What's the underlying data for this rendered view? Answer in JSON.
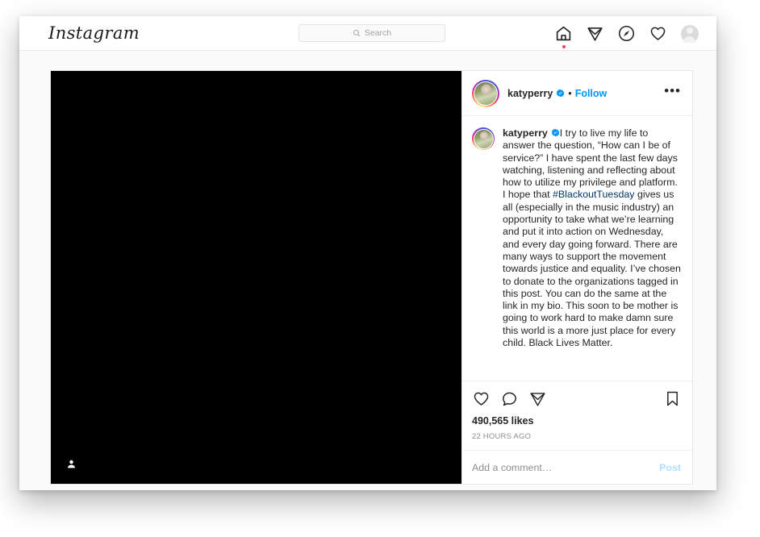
{
  "app": {
    "brand": "Instagram"
  },
  "navbar": {
    "search": {
      "icon": "search-icon",
      "placeholder": "Search",
      "value": ""
    },
    "icons": [
      {
        "name": "home-icon",
        "label": "Home",
        "has_notification_dot": true,
        "dot_color": "#ed4956"
      },
      {
        "name": "direct-message-icon",
        "label": "Direct",
        "has_notification_dot": false
      },
      {
        "name": "explore-icon",
        "label": "Explore",
        "has_notification_dot": false
      },
      {
        "name": "activity-heart-icon",
        "label": "Activity",
        "has_notification_dot": false
      },
      {
        "name": "profile-avatar-icon",
        "label": "Profile",
        "has_notification_dot": false
      }
    ]
  },
  "post": {
    "media": {
      "type": "image",
      "background_color": "#000000",
      "tagged_people_badge": true
    },
    "header": {
      "username": "katyperry",
      "verified": true,
      "separator": "•",
      "follow_label": "Follow",
      "more_options": "•••"
    },
    "caption": {
      "username": "katyperry",
      "verified": true,
      "text": "I try to live my life to answer the question, “How can I be of service?” I have spent the last few days watching, listening and reflecting about how to utilize my privilege and platform. I hope that ",
      "hashtag": "#BlackoutTuesday",
      "text_after": " gives us all (especially in the music industry) an opportunity to take what we’re learning and put it into action on Wednesday, and every day going forward. There are many ways to support the movement towards justice and equality. I’ve chosen to donate to the organizations tagged in this post. You can do the same at the link in my bio. This soon to be mother is going to work hard to make damn sure this world is a more just place for every child. Black Lives Matter."
    },
    "actions": {
      "like_icon": "heart-icon",
      "comment_icon": "comment-icon",
      "share_icon": "share-icon",
      "save_icon": "bookmark-icon",
      "likes": "490,565 likes",
      "timestamp": "22 HOURS AGO"
    },
    "comment_box": {
      "placeholder": "Add a comment…",
      "value": "",
      "post_label": "Post"
    }
  },
  "colors": {
    "accent_blue": "#0095f6",
    "link_blue": "#00376b",
    "post_disabled": "#b2dffc",
    "notification_red": "#ed4956",
    "text_primary": "#262626",
    "text_muted": "#8e8e8e"
  }
}
